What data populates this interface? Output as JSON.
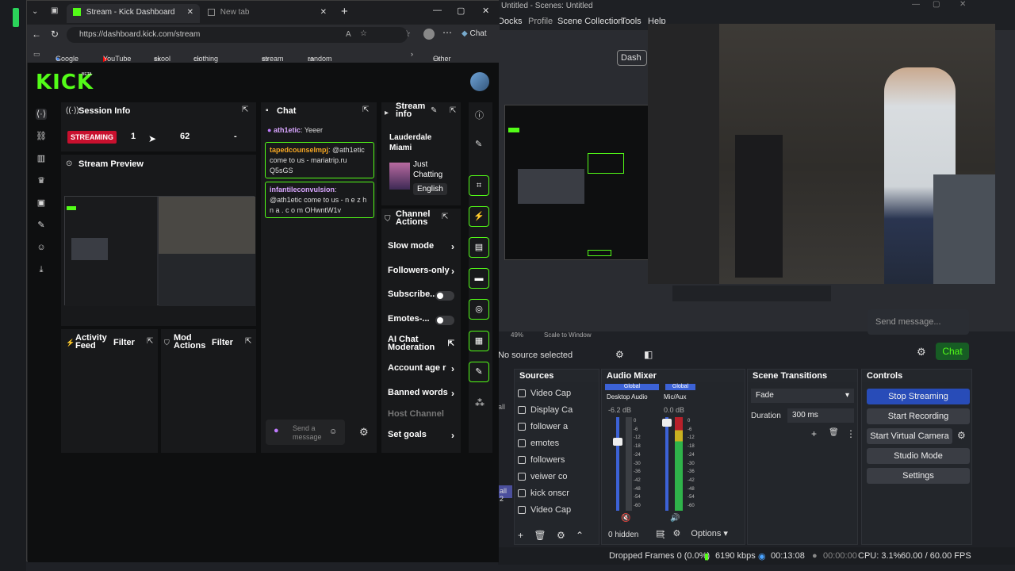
{
  "obs": {
    "title": "Untitled - Scenes: Untitled",
    "menu": [
      "Docks",
      "Profile",
      "Scene Collection",
      "Tools",
      "Help"
    ],
    "dashboard_btn": "Dash",
    "send_message_placeholder": "Send message...",
    "chat_btn": "Chat",
    "preview_zoom": "49%",
    "scale_label": "Scale to Window",
    "no_source": "No source selected",
    "sources_title": "Sources",
    "sources": [
      "Video Cap",
      "Display Ca",
      "follower a",
      "emotes",
      "followers",
      "veiwer co",
      "kick onscr",
      "Video Cap"
    ],
    "mixer_title": "Audio Mixer",
    "mixer": {
      "ch1_global": "Global",
      "ch1_name": "Desktop Audio",
      "ch1_db": "-6.2 dB",
      "ch2_global": "Global",
      "ch2_name": "Mic/Aux",
      "ch2_db": "0.0 dB",
      "scale": [
        "0",
        "-6",
        "-12",
        "-18",
        "-24",
        "-30",
        "-36",
        "-42",
        "-48",
        "-54",
        "-60"
      ]
    },
    "hidden_label": "0 hidden",
    "options_label": "Options",
    "transitions_title": "Scene Transitions",
    "transition": "Fade",
    "duration_label": "Duration",
    "duration_value": "300 ms",
    "controls_title": "Controls",
    "controls": [
      "Stop Streaming",
      "Start Recording",
      "Start Virtual Camera",
      "Studio Mode",
      "Settings"
    ],
    "status": {
      "dropped": "Dropped Frames 0 (0.0%)",
      "kbps": "6190 kbps",
      "live_time": "00:13:08",
      "rec_time": "00:00:00",
      "cpu": "CPU: 3.1%",
      "fps": "60.00 / 60.00 FPS"
    },
    "left_fragments": [
      "all",
      "all 2"
    ]
  },
  "browser": {
    "tabs": [
      {
        "label": "Stream - Kick Dashboard"
      },
      {
        "label": "New tab"
      }
    ],
    "url": "https://dashboard.kick.com/stream",
    "chat_btn": "Chat",
    "bookmarks": [
      "Google",
      "YouTube",
      "skool",
      "clothing brand",
      "stream",
      "random"
    ],
    "other_favorites": "Other favorites"
  },
  "kick": {
    "logo": "KICK",
    "beta": "BETA",
    "session": {
      "title": "Session Info",
      "badge": "STREAMING",
      "viewers": "1",
      "followers": "62",
      "dash": "-"
    },
    "preview_title": "Stream Preview",
    "activity_title": "Activity Feed",
    "activity_filter": "Filter",
    "mod_title": "Mod Actions",
    "mod_filter": "Filter",
    "chat": {
      "title": "Chat",
      "messages": [
        {
          "user": "ath1etic",
          "text": "Yeeer"
        },
        {
          "user": "tapedcounselmpj",
          "text": "@ath1etic come to us - mariatrip.ru Q5sGS"
        },
        {
          "user": "infantileconvulsion",
          "text": "@ath1etic come to us - n e z h n a . c o m OHwntW1v"
        }
      ],
      "send_placeholder": "Send a message"
    },
    "stream_info": {
      "title": "Stream info",
      "stream_title": "Lauderdale Miami",
      "category": "Just Chatting",
      "language": "English"
    },
    "channel_actions": {
      "title": "Channel Actions",
      "slow_mode": "Slow mode",
      "followers_only": "Followers-only",
      "subscribers": "Subscribe...",
      "emotes": "Emotes-...",
      "ai_moderation": "AI Chat Moderation",
      "account_age": "Account age r",
      "banned_words": "Banned words",
      "host_channel": "Host Channel",
      "set_goals": "Set goals"
    }
  }
}
